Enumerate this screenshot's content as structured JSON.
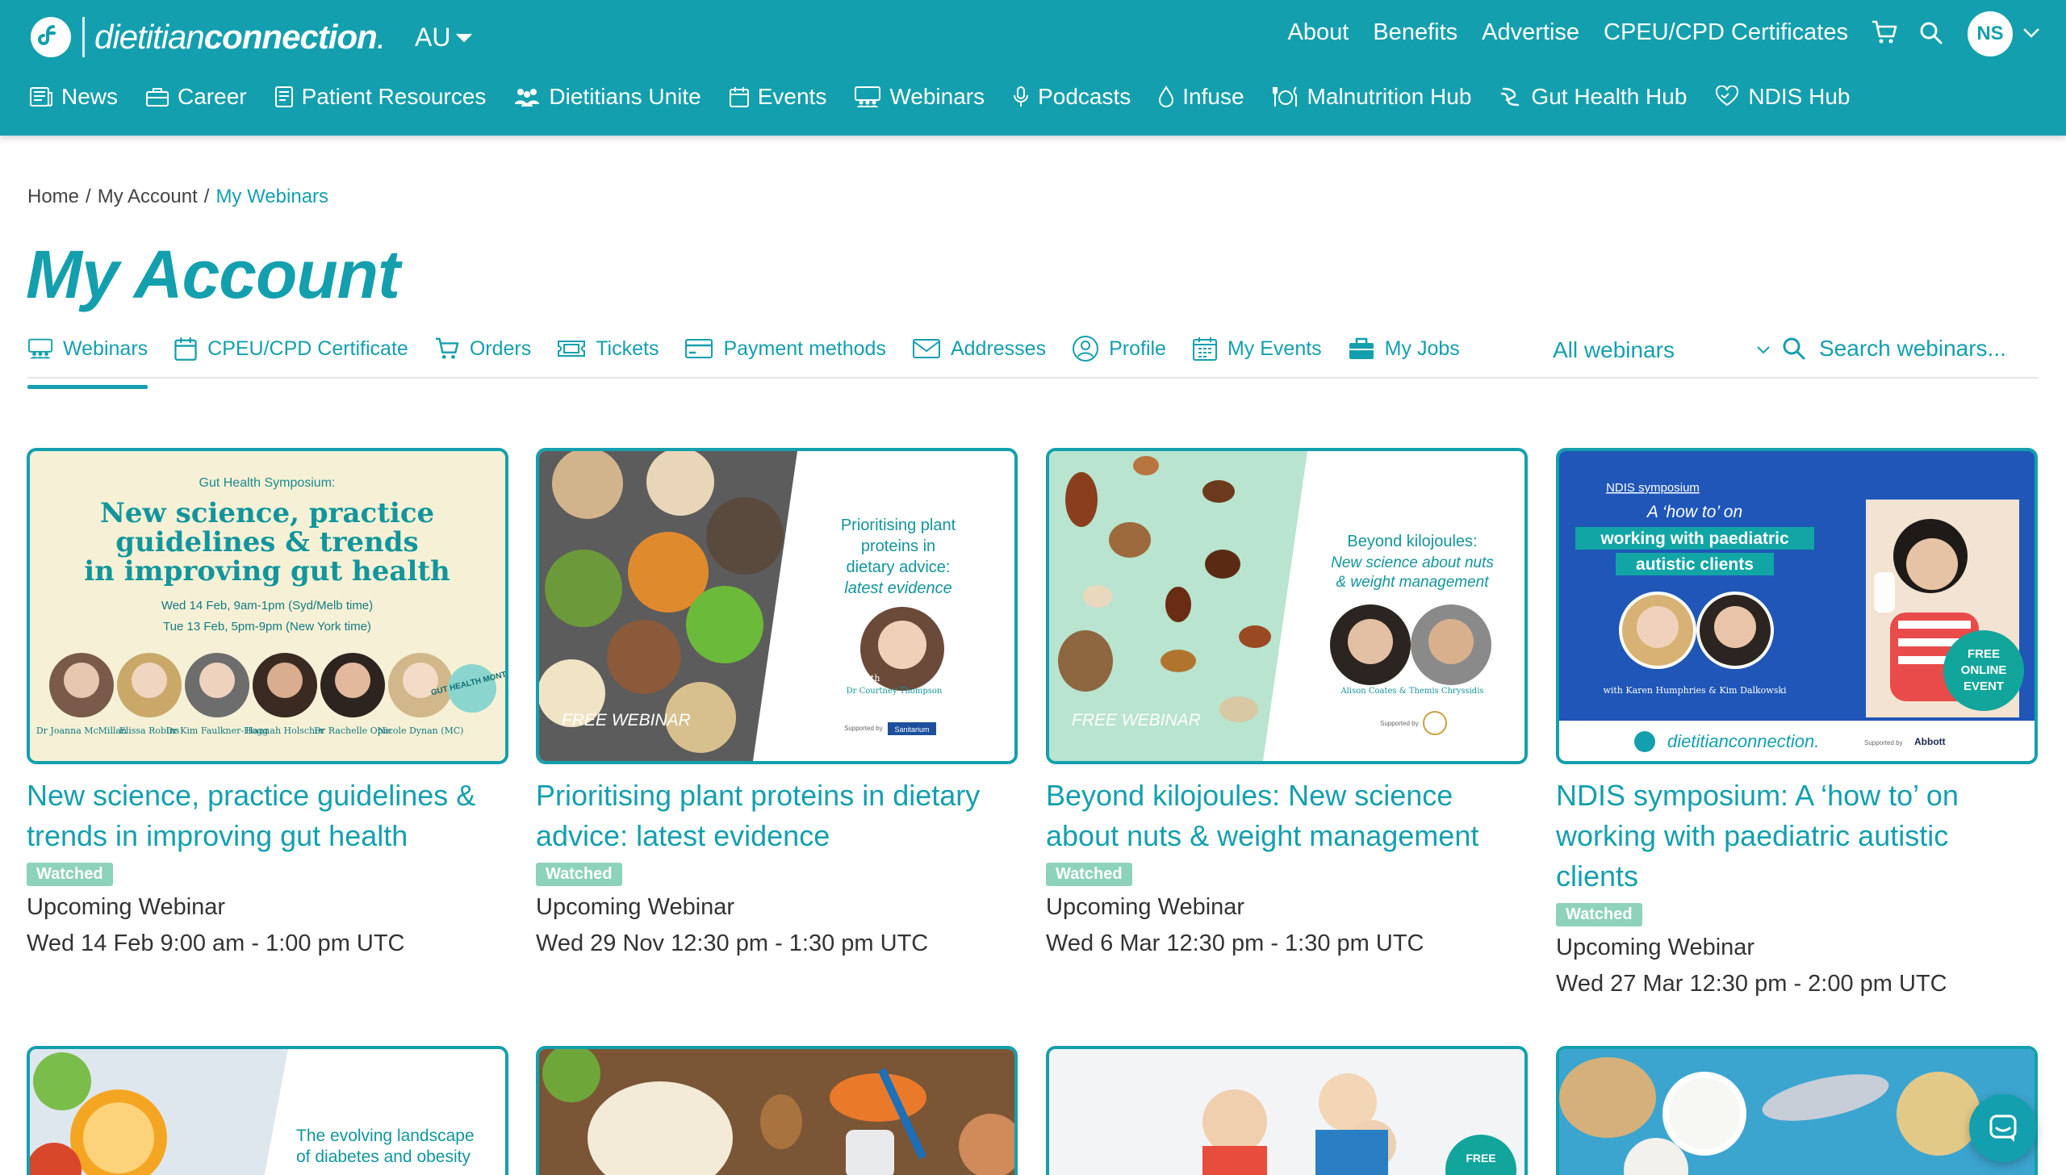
{
  "header": {
    "logo_text_light": "dietitian",
    "logo_text_bold": "connection",
    "logo_tm": ".",
    "region": "AU",
    "top_links": [
      "About",
      "Benefits",
      "Advertise",
      "CPEU/CPD Certificates"
    ],
    "avatar_initials": "NS",
    "nav": [
      {
        "label": "News",
        "icon": "newspaper-icon"
      },
      {
        "label": "Career",
        "icon": "briefcase-icon"
      },
      {
        "label": "Patient Resources",
        "icon": "document-icon"
      },
      {
        "label": "Dietitians Unite",
        "icon": "people-icon"
      },
      {
        "label": "Events",
        "icon": "calendar-icon"
      },
      {
        "label": "Webinars",
        "icon": "webinar-icon"
      },
      {
        "label": "Podcasts",
        "icon": "microphone-icon"
      },
      {
        "label": "Infuse",
        "icon": "drop-icon"
      },
      {
        "label": "Malnutrition Hub",
        "icon": "cutlery-icon"
      },
      {
        "label": "Gut Health Hub",
        "icon": "gut-icon"
      },
      {
        "label": "NDIS Hub",
        "icon": "heart-hands-icon"
      }
    ]
  },
  "breadcrumb": {
    "home": "Home",
    "sep": "/",
    "account": "My Account",
    "current": "My Webinars"
  },
  "page_title": "My Account",
  "tabs": [
    {
      "label": "Webinars",
      "icon": "webinar-icon",
      "active": true
    },
    {
      "label": "CPEU/CPD Certificate",
      "icon": "calendar-icon"
    },
    {
      "label": "Orders",
      "icon": "cart-icon"
    },
    {
      "label": "Tickets",
      "icon": "ticket-icon"
    },
    {
      "label": "Payment methods",
      "icon": "card-icon"
    },
    {
      "label": "Addresses",
      "icon": "envelope-icon"
    },
    {
      "label": "Profile",
      "icon": "user-icon"
    },
    {
      "label": "My Events",
      "icon": "calendar-grid-icon"
    },
    {
      "label": "My Jobs",
      "icon": "briefcase-icon"
    }
  ],
  "filter": {
    "selected": "All webinars"
  },
  "search": {
    "placeholder": "Search webinars..."
  },
  "cards": [
    {
      "title": "New science, practice guidelines & trends in improving gut health",
      "badge": "Watched",
      "type": "Upcoming Webinar",
      "date": "Wed 14 Feb 9:00 am - 1:00 pm UTC",
      "image": {
        "kicker": "Gut Health Symposium:",
        "headline": [
          "New science, practice",
          "guidelines & trends",
          "in improving gut health"
        ],
        "lines": [
          "Wed 14 Feb, 9am-1pm (Syd/Melb time)",
          "Tue 13 Feb, 5pm-9pm (New York time)"
        ],
        "speakers": [
          "Dr Joanna McMillan",
          "Elissa Robins",
          "Dr Kim Faulkner-Hogg",
          "Hannah Holscher",
          "Dr Rachelle Opie",
          "Nicole Dynan (MC)"
        ],
        "stamp": "GUT HEALTH MONTH"
      }
    },
    {
      "title": "Prioritising plant proteins in dietary advice: latest evidence",
      "badge": "Watched",
      "type": "Upcoming Webinar",
      "date": "Wed 29 Nov 12:30 pm - 1:30 pm UTC",
      "image": {
        "headline": [
          "Prioritising plant",
          "proteins in",
          "dietary advice:"
        ],
        "sub": "latest evidence",
        "with": "with",
        "presenter": "Dr Courtney Thompson",
        "ribbon": "FREE WEBINAR",
        "supported": "Supported by",
        "sponsor": "Sanitarium"
      }
    },
    {
      "title": "Beyond kilojoules: New science about nuts & weight management",
      "badge": "Watched",
      "type": "Upcoming Webinar",
      "date": "Wed 6 Mar 12:30 pm - 1:30 pm UTC",
      "image": {
        "headline": "Beyond kilojoules:",
        "sub": [
          "New science about nuts",
          "& weight management"
        ],
        "with": "with",
        "presenter": "Alison Coates & Themis Chryssidis",
        "ribbon": "FREE WEBINAR",
        "supported": "Supported by"
      }
    },
    {
      "title": "NDIS symposium: A ‘how to’ on working with paediatric autistic clients",
      "badge": "Watched",
      "type": "Upcoming Webinar",
      "date": "Wed 27 Mar 12:30 pm - 2:00 pm UTC",
      "image": {
        "kicker": "NDIS symposium",
        "headline": [
          "A ‘how to’ on",
          "working with paediatric",
          "autistic clients"
        ],
        "presenter": "with Karen Humphries & Kim Dalkowski",
        "stamp": [
          "FREE",
          "ONLINE",
          "EVENT"
        ],
        "brand": "dietitianconnection.",
        "supported": "Supported by",
        "sponsor": "Abbott"
      }
    }
  ],
  "bottom_cards": [
    {
      "image_text": [
        "The evolving landscape",
        "of diabetes and obesity"
      ]
    },
    {
      "image_text": []
    },
    {
      "image_text": [
        "FREE"
      ]
    },
    {
      "image_text": []
    }
  ],
  "colors": {
    "brand": "#149fae",
    "watched_badge": "#8dd2ba",
    "text": "#333333"
  }
}
